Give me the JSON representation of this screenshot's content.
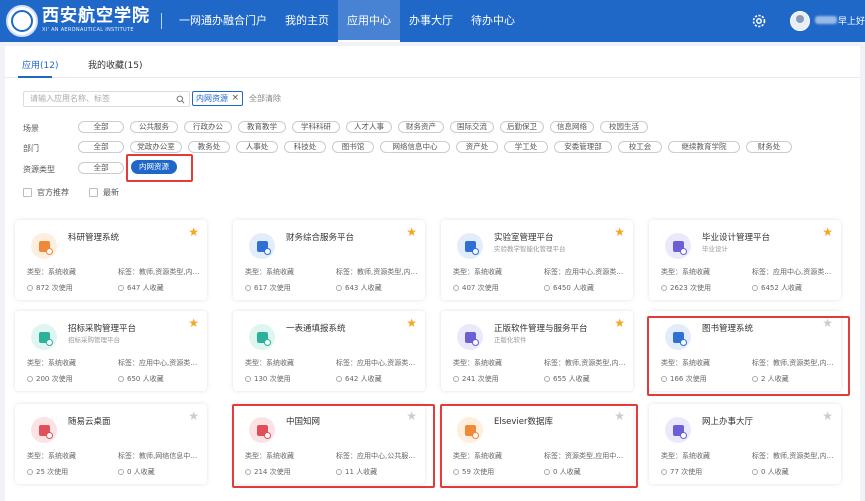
{
  "header": {
    "logo_cn": "西安航空学院",
    "logo_en": "XI' AN AERONAUTICAL INSTITUTE",
    "nav": [
      "一网通办融合门户",
      "我的主页",
      "应用中心",
      "办事大厅",
      "待办中心"
    ],
    "active_nav": "应用中心",
    "greeting": "早上好"
  },
  "tabs": {
    "apps": "应用(12)",
    "favorites": "我的收藏(15)"
  },
  "search": {
    "placeholder": "请输入应用名称、标签"
  },
  "active_filter": {
    "label": "内网资源",
    "clear_all": "全部清除"
  },
  "filters": {
    "scene": {
      "label": "场景",
      "options": [
        "全部",
        "公共服务",
        "行政办公",
        "教育教学",
        "学科科研",
        "人才人事",
        "财务资产",
        "国际交流",
        "后勤保卫",
        "信息网络",
        "校园生活"
      ]
    },
    "department": {
      "label": "部门",
      "options": [
        "全部",
        "党政办公室",
        "教务处",
        "人事处",
        "科技处",
        "图书馆",
        "网络信息中心",
        "资产处",
        "学工处",
        "安委管理部",
        "校工会",
        "继续教育学院",
        "财务处"
      ]
    },
    "resource_type": {
      "label": "资源类型",
      "options": [
        "全部",
        "内网资源"
      ],
      "selected": "内网资源"
    }
  },
  "checks": {
    "official": "官方推荐",
    "latest": "最新"
  },
  "cards": [
    {
      "title": "科研管理系统",
      "subtitle": "",
      "type": "类型：系统收藏",
      "tags": "标签：教师,资源类型,内网...",
      "uses": "872 次使用",
      "favs": "647 人收藏",
      "starred": true,
      "icon": "research-icon",
      "icon_color": "#f0883a",
      "icon_bg": "#fdeede"
    },
    {
      "title": "财务综合服务平台",
      "subtitle": "",
      "type": "类型：系统收藏",
      "tags": "标签：教师,资源类型,内网...",
      "uses": "617 次使用",
      "favs": "643 人收藏",
      "starred": true,
      "icon": "finance-icon",
      "icon_color": "#2f6fd6",
      "icon_bg": "#e3ecfb"
    },
    {
      "title": "实验室管理平台",
      "subtitle": "实验教学智能化管理平台",
      "type": "类型：系统收藏",
      "tags": "标签：应用中心,资源类型,...",
      "uses": "407 次使用",
      "favs": "6450 人收藏",
      "starred": true,
      "icon": "lab-icon",
      "icon_color": "#2f6fd6",
      "icon_bg": "#e3ecfb"
    },
    {
      "title": "毕业设计管理平台",
      "subtitle": "毕业设计",
      "type": "类型：系统收藏",
      "tags": "标签：应用中心,资源类型,...",
      "uses": "2623 次使用",
      "favs": "6452 人收藏",
      "starred": true,
      "icon": "thesis-icon",
      "icon_color": "#6a5fd6",
      "icon_bg": "#ebe8fb"
    },
    {
      "title": "招标采购管理平台",
      "subtitle": "招标采购管理平台",
      "type": "类型：系统收藏",
      "tags": "标签：应用中心,资源类型,...",
      "uses": "200 次使用",
      "favs": "650 人收藏",
      "starred": true,
      "icon": "procurement-icon",
      "icon_color": "#2bb39a",
      "icon_bg": "#dff5f0"
    },
    {
      "title": "一表通填报系统",
      "subtitle": "",
      "type": "类型：系统收藏",
      "tags": "标签：应用中心,资源类型,...",
      "uses": "130 次使用",
      "favs": "642 人收藏",
      "starred": true,
      "icon": "form-icon",
      "icon_color": "#2bb39a",
      "icon_bg": "#dff5f0"
    },
    {
      "title": "正版软件管理与服务平台",
      "subtitle": "正版化软件",
      "type": "类型：系统收藏",
      "tags": "标签：教师,资源类型,内网...",
      "uses": "241 次使用",
      "favs": "655 人收藏",
      "starred": true,
      "icon": "software-icon",
      "icon_color": "#6a5fd6",
      "icon_bg": "#ebe8fb"
    },
    {
      "title": "图书管理系统",
      "subtitle": "",
      "type": "类型：系统收藏",
      "tags": "标签：教师,资源类型,内网...",
      "uses": "166 次使用",
      "favs": "2 人收藏",
      "starred": false,
      "icon": "library-icon",
      "icon_color": "#2f6fd6",
      "icon_bg": "#e3ecfb"
    },
    {
      "title": "随易云桌面",
      "subtitle": "",
      "type": "类型：系统收藏",
      "tags": "标签：教师,网络信息中心,...",
      "uses": "25 次使用",
      "favs": "0 人收藏",
      "starred": false,
      "icon": "desktop-icon",
      "icon_color": "#e0505a",
      "icon_bg": "#fbe3e5"
    },
    {
      "title": "中国知网",
      "subtitle": "",
      "type": "类型：系统收藏",
      "tags": "标签：应用中心,公共服务,...",
      "uses": "214 次使用",
      "favs": "11 人收藏",
      "starred": false,
      "icon": "cnki-icon",
      "icon_color": "#e0505a",
      "icon_bg": "#fbe3e5"
    },
    {
      "title": "Elsevier数据库",
      "subtitle": "",
      "type": "类型：系统收藏",
      "tags": "标签：资源类型,应用中心,...",
      "uses": "59 次使用",
      "favs": "0 人收藏",
      "starred": false,
      "icon": "database-icon",
      "icon_color": "#f0883a",
      "icon_bg": "#fdeede"
    },
    {
      "title": "网上办事大厅",
      "subtitle": "",
      "type": "类型：系统收藏",
      "tags": "标签：教师,资源类型,内网...",
      "uses": "77 次使用",
      "favs": "0 人收藏",
      "starred": false,
      "icon": "service-hall-icon",
      "icon_color": "#6a5fd6",
      "icon_bg": "#ebe8fb"
    }
  ],
  "colors": {
    "primary": "#1f68c8",
    "highlight_box": "#e23b3b",
    "star": "#f5a623"
  }
}
